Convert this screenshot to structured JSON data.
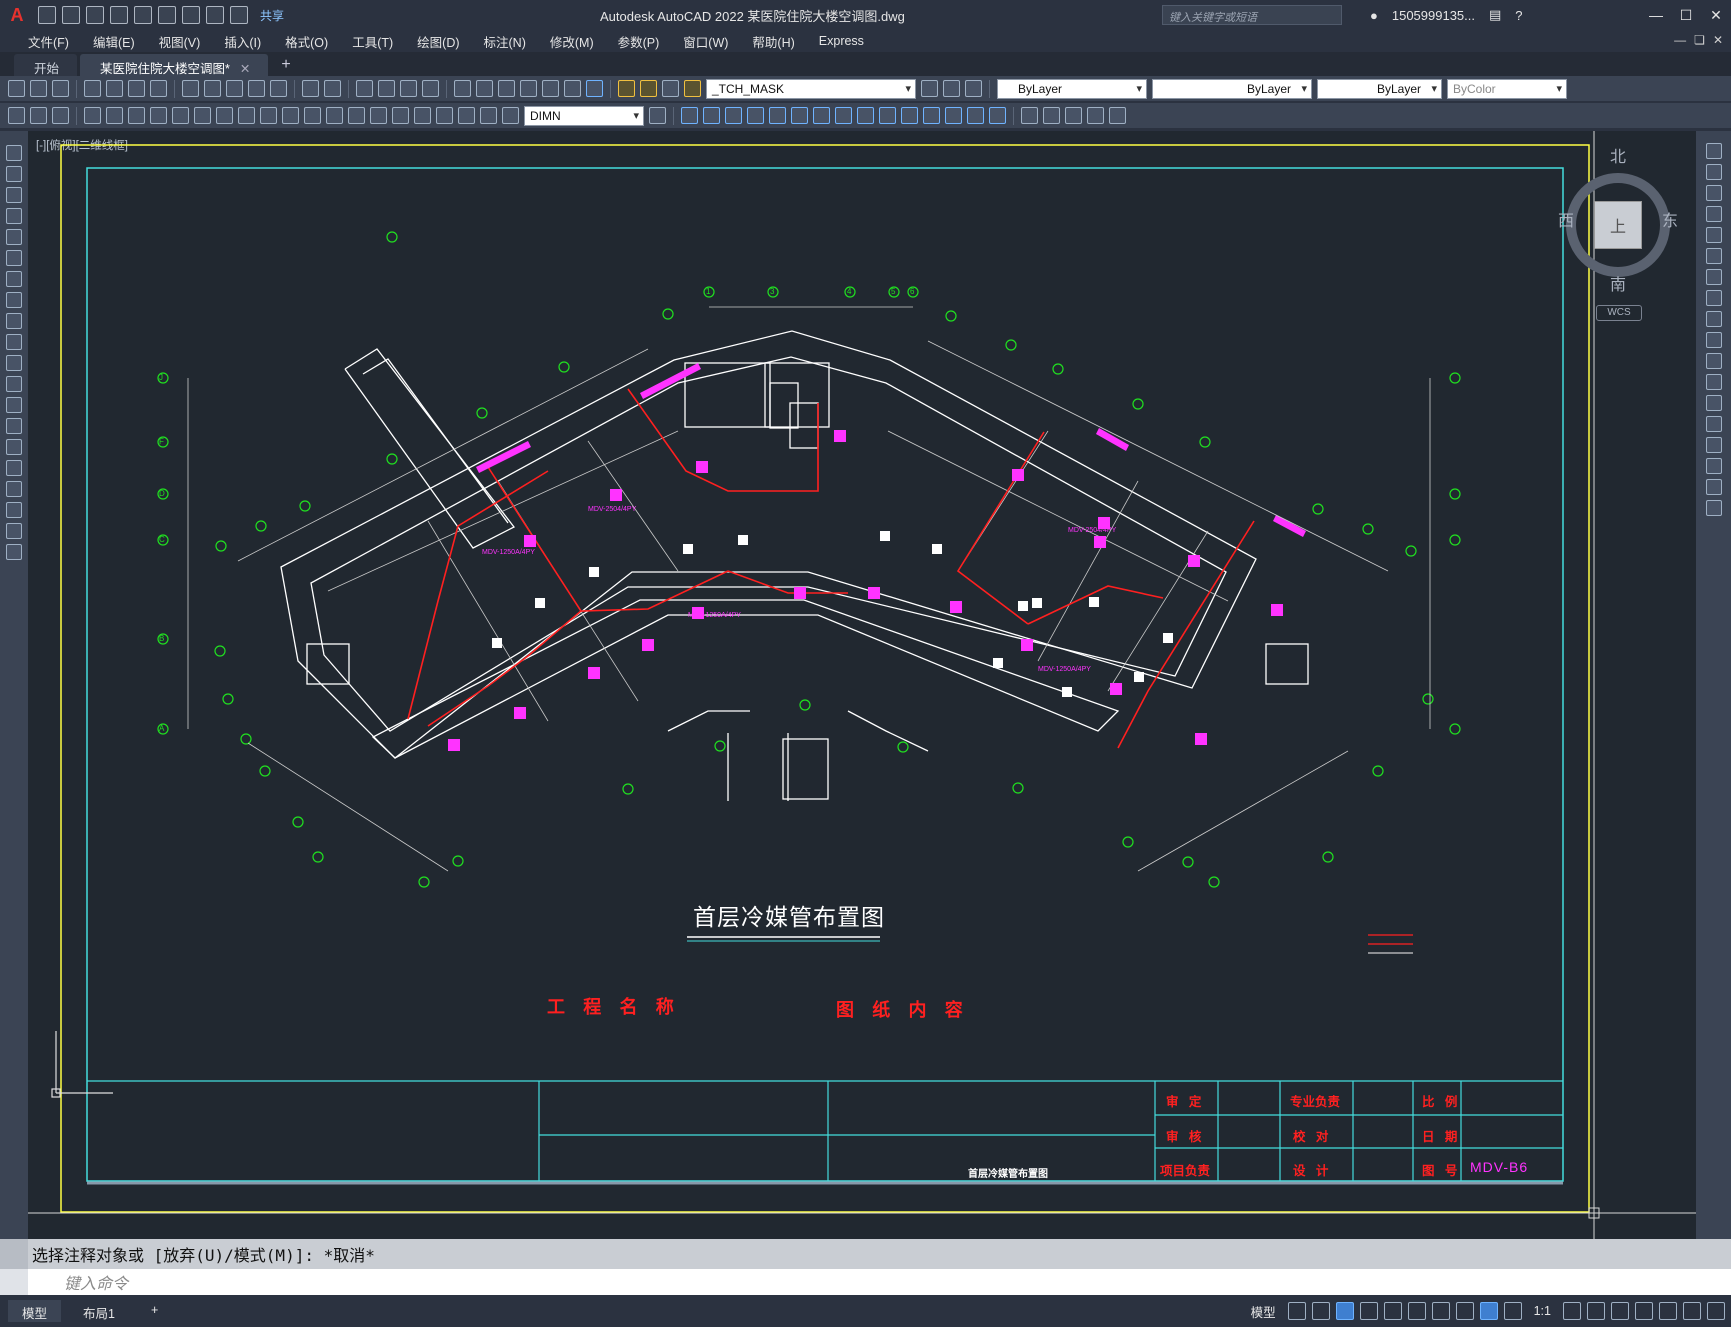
{
  "app": {
    "window_title": "Autodesk AutoCAD 2022    某医院住院大楼空调图.dwg",
    "share_label": "共享",
    "search_placeholder": "键入关键字或短语",
    "user_id": "1505999135...",
    "logo": "A"
  },
  "menus": [
    "文件(F)",
    "编辑(E)",
    "视图(V)",
    "插入(I)",
    "格式(O)",
    "工具(T)",
    "绘图(D)",
    "标注(N)",
    "修改(M)",
    "参数(P)",
    "窗口(W)",
    "帮助(H)",
    "Express"
  ],
  "tabs": [
    {
      "label": "开始",
      "active": false
    },
    {
      "label": "某医院住院大楼空调图*",
      "active": true
    }
  ],
  "toolbar": {
    "layer_value": "_TCH_MASK",
    "color_value": "ByLayer",
    "linetype_value": "ByLayer",
    "lineweight_value": "ByLayer",
    "plotstyle_value": "ByColor",
    "dimstyle_value": "DIMN"
  },
  "viewport": {
    "label": "[-][俯视][二维线框]",
    "viewcube": {
      "north": "北",
      "south": "南",
      "east": "东",
      "west": "西",
      "face": "上",
      "wcs": "WCS"
    }
  },
  "drawing": {
    "title": "首层冷媒管布置图",
    "titleblock": {
      "project_name_label": "工 程 名 称",
      "content_label": "图 纸 内 容",
      "content_value": "首层冷媒管布置图",
      "roles": [
        "审 定",
        "专业负责",
        "比 例",
        "审 核",
        "校 对",
        "日 期",
        "项目负责",
        "设 计",
        "图 号"
      ],
      "drawing_number": "MDV-B6"
    },
    "axis_labels_left": [
      "J",
      "F",
      "D",
      "C",
      "B",
      "A"
    ],
    "axis_labels_top": [
      "1",
      "3",
      "4",
      "5",
      "6"
    ],
    "sample_units": [
      "MDV-1250A/4PY",
      "MDV-2504/4PY",
      "MDV-1250A/4PY",
      "MDV-2504/4PY",
      "MDV-1250A/4PY"
    ],
    "colors": {
      "wall": "#ffffff",
      "pipe": "#ff2020",
      "unit": "#ff33ff",
      "grid": "#20e020",
      "frame_outer": "#ffff44",
      "frame_inner": "#44dddd"
    }
  },
  "command": {
    "history": "选择注释对象或 [放弃(U)/模式(M)]: *取消*",
    "placeholder": "键入命令"
  },
  "status": {
    "layout_tabs": [
      "模型",
      "布局1"
    ],
    "model_label": "模型",
    "scale_label": "1:1"
  }
}
